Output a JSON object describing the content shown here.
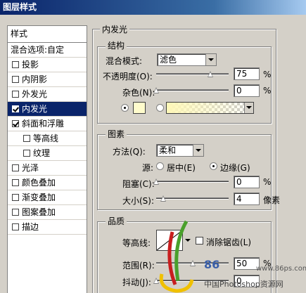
{
  "window": {
    "title": "图层样式"
  },
  "style_list": {
    "header": "样式",
    "items": [
      {
        "label": "混合选项:自定",
        "checkbox": false,
        "checked": false,
        "indent": false,
        "active": false
      },
      {
        "label": "投影",
        "checkbox": true,
        "checked": false,
        "indent": false,
        "active": false
      },
      {
        "label": "内阴影",
        "checkbox": true,
        "checked": false,
        "indent": false,
        "active": false
      },
      {
        "label": "外发光",
        "checkbox": true,
        "checked": false,
        "indent": false,
        "active": false
      },
      {
        "label": "内发光",
        "checkbox": true,
        "checked": true,
        "indent": false,
        "active": true
      },
      {
        "label": "斜面和浮雕",
        "checkbox": true,
        "checked": true,
        "indent": false,
        "active": false
      },
      {
        "label": "等高线",
        "checkbox": true,
        "checked": false,
        "indent": true,
        "active": false
      },
      {
        "label": "纹理",
        "checkbox": true,
        "checked": false,
        "indent": true,
        "active": false
      },
      {
        "label": "光泽",
        "checkbox": true,
        "checked": false,
        "indent": false,
        "active": false
      },
      {
        "label": "颜色叠加",
        "checkbox": true,
        "checked": false,
        "indent": false,
        "active": false
      },
      {
        "label": "渐变叠加",
        "checkbox": true,
        "checked": false,
        "indent": false,
        "active": false
      },
      {
        "label": "图案叠加",
        "checkbox": true,
        "checked": false,
        "indent": false,
        "active": false
      },
      {
        "label": "描边",
        "checkbox": true,
        "checked": false,
        "indent": false,
        "active": false
      }
    ]
  },
  "inner_glow": {
    "title": "内发光",
    "structure": {
      "title": "结构",
      "blend_mode_label": "混合模式:",
      "blend_mode_value": "滤色",
      "opacity_label": "不透明度(O):",
      "opacity_value": "75",
      "opacity_level": 75,
      "noise_label": "杂色(N):",
      "noise_value": "0",
      "noise_level": 0,
      "unit_percent": "%",
      "glow_color": "#fffccc"
    },
    "elements": {
      "title": "图素",
      "method_label": "方法(Q):",
      "method_value": "柔和",
      "source_label": "源:",
      "source_center": "居中(E)",
      "source_edge": "边缘(G)",
      "choke_label": "阻塞(C):",
      "choke_value": "0",
      "choke_level": 0,
      "size_label": "大小(S):",
      "size_value": "4",
      "size_unit": "像素",
      "unit_percent": "%"
    },
    "quality": {
      "title": "品质",
      "contour_label": "等高线:",
      "antialias_label": "消除锯齿(L)",
      "range_label": "范围(R):",
      "range_value": "50",
      "range_level": 50,
      "jitter_label": "抖动(J):",
      "jitter_value": "0",
      "jitter_level": 0,
      "unit_percent": "%"
    }
  },
  "watermark": {
    "site": "www.86ps.com",
    "brand": "86",
    "text": "中国Photoshop资源网"
  },
  "colors": {
    "titlebar": "#0a246a",
    "selection": "#0a246a",
    "dialog": "#d4d0c8"
  }
}
